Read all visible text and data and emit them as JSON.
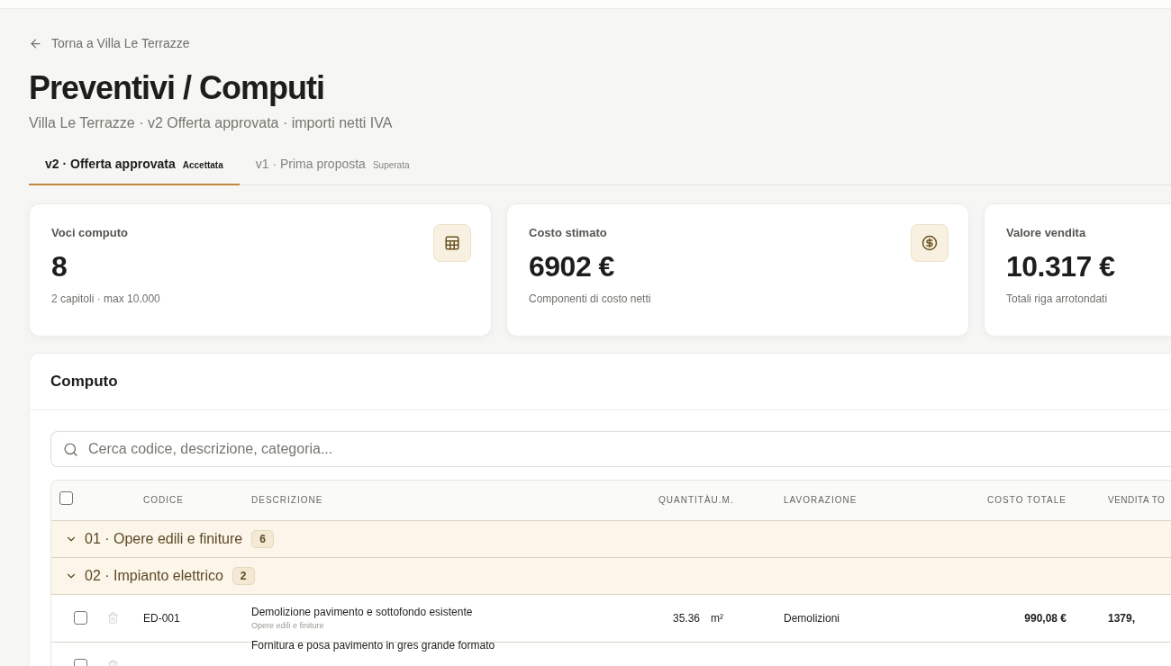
{
  "back_link": "Torna a Villa Le Terrazze",
  "title": "Preventivi / Computi",
  "subtitle": "Villa Le Terrazze · v2 Offerta approvata · importi netti IVA",
  "tabs": [
    {
      "label": "v2 · Offerta approvata",
      "badge": "Accettata",
      "selected": true
    },
    {
      "label": "v1 · Prima proposta",
      "badge": "Superata",
      "selected": false
    }
  ],
  "stats": [
    {
      "label": "Voci computo",
      "value": "8",
      "note": "2 capitoli · max 10.000",
      "kind": "table"
    },
    {
      "label": "Costo stimato",
      "value": "6902 €",
      "note": "Componenti di costo netti",
      "kind": "money"
    },
    {
      "label": "Valore vendita",
      "value": "10.317 €",
      "note": "Totali riga arrotondati"
    }
  ],
  "computo": {
    "title": "Computo",
    "search": {
      "placeholder": "Cerca codice, descrizione, categoria..."
    },
    "select_all": {
      "checked": false
    },
    "columns": [
      "CODICE",
      "DESCRIZIONE",
      "QUANTITÀ",
      "U.M.",
      "LAVORAZIONE",
      "COSTO TOTALE",
      "VENDITA TO"
    ],
    "groups": [
      {
        "label": "01 · Opere edili e finiture",
        "count": "6",
        "expanded": true
      },
      {
        "label": "02 · Impianto elettrico",
        "count": "2",
        "expanded": true
      }
    ],
    "rows": [
      {
        "checked": false,
        "code": "ED-001",
        "description": "Demolizione pavimento e sottofondo esistente",
        "category": "Opere edili e finiture",
        "quantity": "35.36",
        "unit": "m²",
        "work": "Demolizioni",
        "cost": "990,08 €",
        "sale": "1379,"
      },
      {
        "checked": false,
        "description": "Fornitura e posa pavimento in gres grande formato"
      }
    ]
  }
}
